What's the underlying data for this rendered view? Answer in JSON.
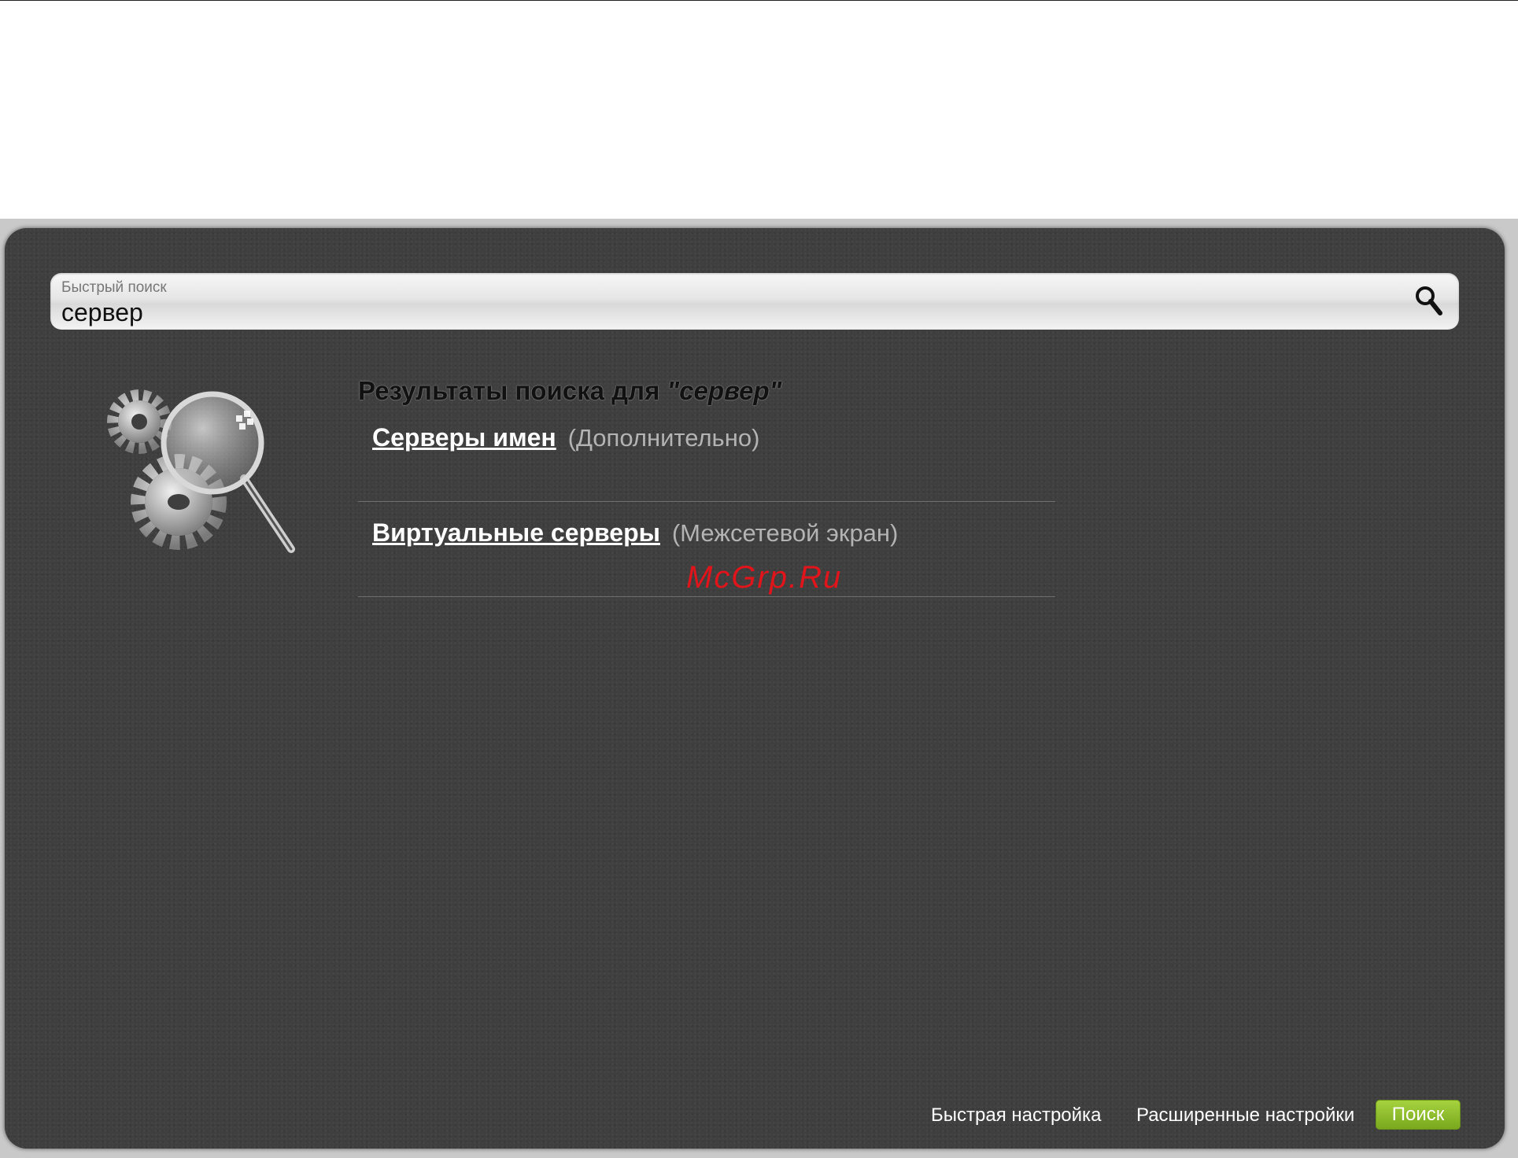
{
  "search": {
    "label": "Быстрый поиск",
    "value": "сервер"
  },
  "results": {
    "title_prefix": "Результаты поиска для",
    "query_quoted": "\"сервер\"",
    "items": [
      {
        "link": "Серверы имен",
        "section": "(Дополнительно)"
      },
      {
        "link": "Виртуальные серверы",
        "section": "(Межсетевой экран)"
      }
    ]
  },
  "watermark": "McGrp.Ru",
  "footer": {
    "quick_setup": "Быстрая настройка",
    "advanced_settings": "Расширенные настройки",
    "search_button": "Поиск"
  },
  "colors": {
    "panel": "#3f3f3f",
    "search_button": "#8fbf2e",
    "watermark": "#e0141b"
  },
  "icons": {
    "search": "magnifier-icon",
    "illustration": "gears-magnifier-icon"
  }
}
